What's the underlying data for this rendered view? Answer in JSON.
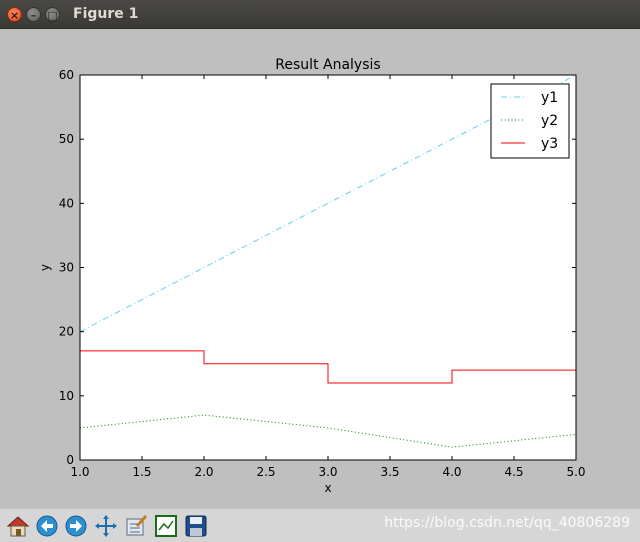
{
  "window": {
    "title": "Figure 1"
  },
  "toolbar": {
    "buttons": [
      "home-icon",
      "back-arrow-icon",
      "forward-arrow-icon",
      "pan-icon",
      "configure-subplots-icon",
      "zoom-rect-icon",
      "save-icon"
    ]
  },
  "watermark": "https://blog.csdn.net/qq_40806289",
  "chart_data": {
    "type": "line",
    "title": "Result Analysis",
    "xlabel": "x",
    "ylabel": "y",
    "xlim": [
      1.0,
      5.0
    ],
    "ylim": [
      0,
      60
    ],
    "x_ticks": [
      "1.0",
      "1.5",
      "2.0",
      "2.5",
      "3.0",
      "3.5",
      "4.0",
      "4.5",
      "5.0"
    ],
    "y_ticks": [
      "0",
      "10",
      "20",
      "30",
      "40",
      "50",
      "60"
    ],
    "grid": false,
    "legend_position": "upper right",
    "series": [
      {
        "name": "y1",
        "style": "dashdot",
        "color": "#5fd3e8",
        "x": [
          1,
          2,
          3,
          4,
          5
        ],
        "y": [
          20,
          30,
          40,
          50,
          60
        ]
      },
      {
        "name": "y2",
        "style": "dotted",
        "color": "#008000",
        "x": [
          1,
          2,
          3,
          4,
          5
        ],
        "y": [
          5,
          7,
          5,
          2,
          4
        ]
      },
      {
        "name": "y3",
        "style": "steps-post",
        "color": "#ff0000",
        "x": [
          1,
          2,
          3,
          4,
          5
        ],
        "y": [
          17,
          15,
          12,
          14,
          14
        ]
      }
    ]
  }
}
